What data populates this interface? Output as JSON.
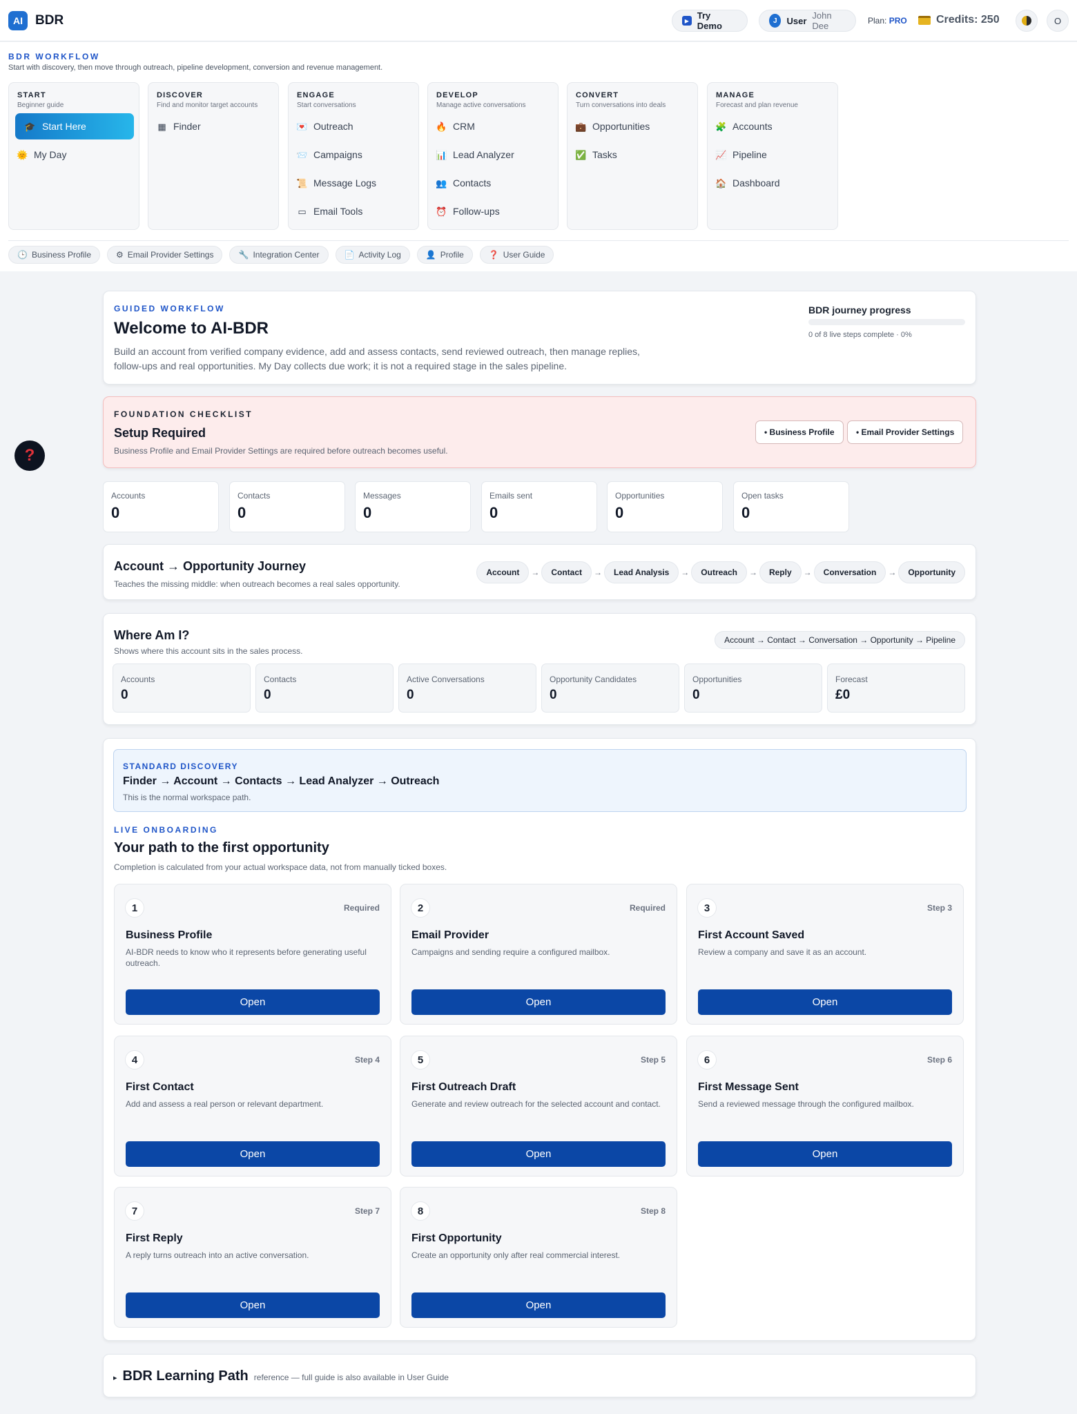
{
  "topbar": {
    "logo": "AI",
    "brand": "BDR",
    "try_demo": "Try Demo",
    "user_label": "User",
    "user_name": "John Dee",
    "user_initial": "J",
    "plan_label": "Plan:",
    "plan_value": "PRO",
    "credits": "Credits: 250",
    "more_icon": "O"
  },
  "workflow": {
    "title": "BDR WORKFLOW",
    "subtitle": "Start with discovery, then move through outreach, pipeline development, conversion and revenue management.",
    "groups": [
      {
        "title": "START",
        "subtitle": "Beginner guide",
        "items": [
          {
            "label": "Start Here",
            "icon": "graduation-cap-icon"
          },
          {
            "label": "My Day",
            "icon": "sun-icon"
          }
        ]
      },
      {
        "title": "DISCOVER",
        "subtitle": "Find and monitor target accounts",
        "items": [
          {
            "label": "Finder",
            "icon": "grid-icon"
          }
        ]
      },
      {
        "title": "ENGAGE",
        "subtitle": "Start conversations",
        "items": [
          {
            "label": "Outreach",
            "icon": "envelope-icon"
          },
          {
            "label": "Campaigns",
            "icon": "mail-icon"
          },
          {
            "label": "Message Logs",
            "icon": "scroll-icon"
          },
          {
            "label": "Email Tools",
            "icon": "box-icon"
          }
        ]
      },
      {
        "title": "DEVELOP",
        "subtitle": "Manage active conversations",
        "items": [
          {
            "label": "CRM",
            "icon": "fire-icon"
          },
          {
            "label": "Lead Analyzer",
            "icon": "bar-chart-icon"
          },
          {
            "label": "Contacts",
            "icon": "people-icon"
          },
          {
            "label": "Follow-ups",
            "icon": "alarm-icon"
          }
        ]
      },
      {
        "title": "CONVERT",
        "subtitle": "Turn conversations into deals",
        "items": [
          {
            "label": "Opportunities",
            "icon": "briefcase-icon"
          },
          {
            "label": "Tasks",
            "icon": "checkbox-icon"
          }
        ]
      },
      {
        "title": "MANAGE",
        "subtitle": "Forecast and plan revenue",
        "items": [
          {
            "label": "Accounts",
            "icon": "puzzle-icon"
          },
          {
            "label": "Pipeline",
            "icon": "chart-icon"
          },
          {
            "label": "Dashboard",
            "icon": "house-icon"
          }
        ]
      }
    ],
    "chips": [
      {
        "label": "Business Profile",
        "icon": "clock-icon"
      },
      {
        "label": "Email Provider Settings",
        "icon": "gear-icon"
      },
      {
        "label": "Integration Center",
        "icon": "wrench-icon"
      },
      {
        "label": "Activity Log",
        "icon": "document-icon"
      },
      {
        "label": "Profile",
        "icon": "person-icon"
      },
      {
        "label": "User Guide",
        "icon": "question-icon"
      }
    ]
  },
  "welcome": {
    "kicker": "GUIDED WORKFLOW",
    "title": "Welcome to AI-BDR",
    "body_1": "Build an account from verified company evidence, add and assess contacts, send reviewed outreach, then manage replies,",
    "body_2": "follow-ups and real opportunities. My Day collects due work; it is not a required stage in the sales pipeline.",
    "progress_title": "BDR journey progress",
    "progress_text": "0 of 8 live steps complete · 0%",
    "progress_fraction": 0
  },
  "setup": {
    "kicker": "FOUNDATION CHECKLIST",
    "title": "Setup Required",
    "body": "Business Profile and Email Provider Settings are required before outreach becomes useful.",
    "btn_profile": "• Business Profile",
    "btn_email": "• Email Provider Settings"
  },
  "stats": [
    {
      "label": "Accounts",
      "value": "0"
    },
    {
      "label": "Contacts",
      "value": "0"
    },
    {
      "label": "Messages",
      "value": "0"
    },
    {
      "label": "Emails sent",
      "value": "0"
    },
    {
      "label": "Opportunities",
      "value": "0"
    },
    {
      "label": "Open tasks",
      "value": "0"
    }
  ],
  "journey": {
    "title": "Account → Opportunity Journey",
    "subtitle": "Teaches the missing middle: when outreach becomes a real sales opportunity.",
    "steps": [
      "Account",
      "Contact",
      "Lead Analysis",
      "Outreach",
      "Reply",
      "Conversation",
      "Opportunity"
    ],
    "arrow": "→"
  },
  "where": {
    "title": "Where Am I?",
    "subtitle": "Shows where this account sits in the sales process.",
    "path": "Account → Contact → Conversation → Opportunity → Pipeline",
    "boxes": [
      {
        "label": "Accounts",
        "value": "0"
      },
      {
        "label": "Contacts",
        "value": "0"
      },
      {
        "label": "Active Conversations",
        "value": "0"
      },
      {
        "label": "Opportunity Candidates",
        "value": "0"
      },
      {
        "label": "Opportunities",
        "value": "0"
      },
      {
        "label": "Forecast",
        "value": "£0"
      }
    ]
  },
  "discovery": {
    "kicker": "STANDARD DISCOVERY",
    "path": "Finder → Account → Contacts → Lead Analyzer → Outreach",
    "note": "This is the normal workspace path."
  },
  "onboarding": {
    "kicker": "LIVE ONBOARDING",
    "title": "Your path to the first opportunity",
    "subtitle": "Completion is calculated from your actual workspace data, not from manually ticked boxes.",
    "steps": [
      {
        "num": "1",
        "tag": "Required",
        "title": "Business Profile",
        "desc": "AI-BDR needs to know who it represents before generating useful outreach.",
        "button": "Open"
      },
      {
        "num": "2",
        "tag": "Required",
        "title": "Email Provider",
        "desc": "Campaigns and sending require a configured mailbox.",
        "button": "Open"
      },
      {
        "num": "3",
        "tag": "Step 3",
        "title": "First Account Saved",
        "desc": "Review a company and save it as an account.",
        "button": "Open"
      },
      {
        "num": "4",
        "tag": "Step 4",
        "title": "First Contact",
        "desc": "Add and assess a real person or relevant department.",
        "button": "Open"
      },
      {
        "num": "5",
        "tag": "Step 5",
        "title": "First Outreach Draft",
        "desc": "Generate and review outreach for the selected account and contact.",
        "button": "Open"
      },
      {
        "num": "6",
        "tag": "Step 6",
        "title": "First Message Sent",
        "desc": "Send a reviewed message through the configured mailbox.",
        "button": "Open"
      },
      {
        "num": "7",
        "tag": "Step 7",
        "title": "First Reply",
        "desc": "A reply turns outreach into an active conversation.",
        "button": "Open"
      },
      {
        "num": "8",
        "tag": "Step 8",
        "title": "First Opportunity",
        "desc": "Create an opportunity only after real commercial interest.",
        "button": "Open"
      }
    ]
  },
  "learning": {
    "marker": "▸",
    "title": "BDR Learning Path",
    "note": "reference — full guide is also available in User Guide"
  },
  "help": {
    "icon": "?"
  }
}
